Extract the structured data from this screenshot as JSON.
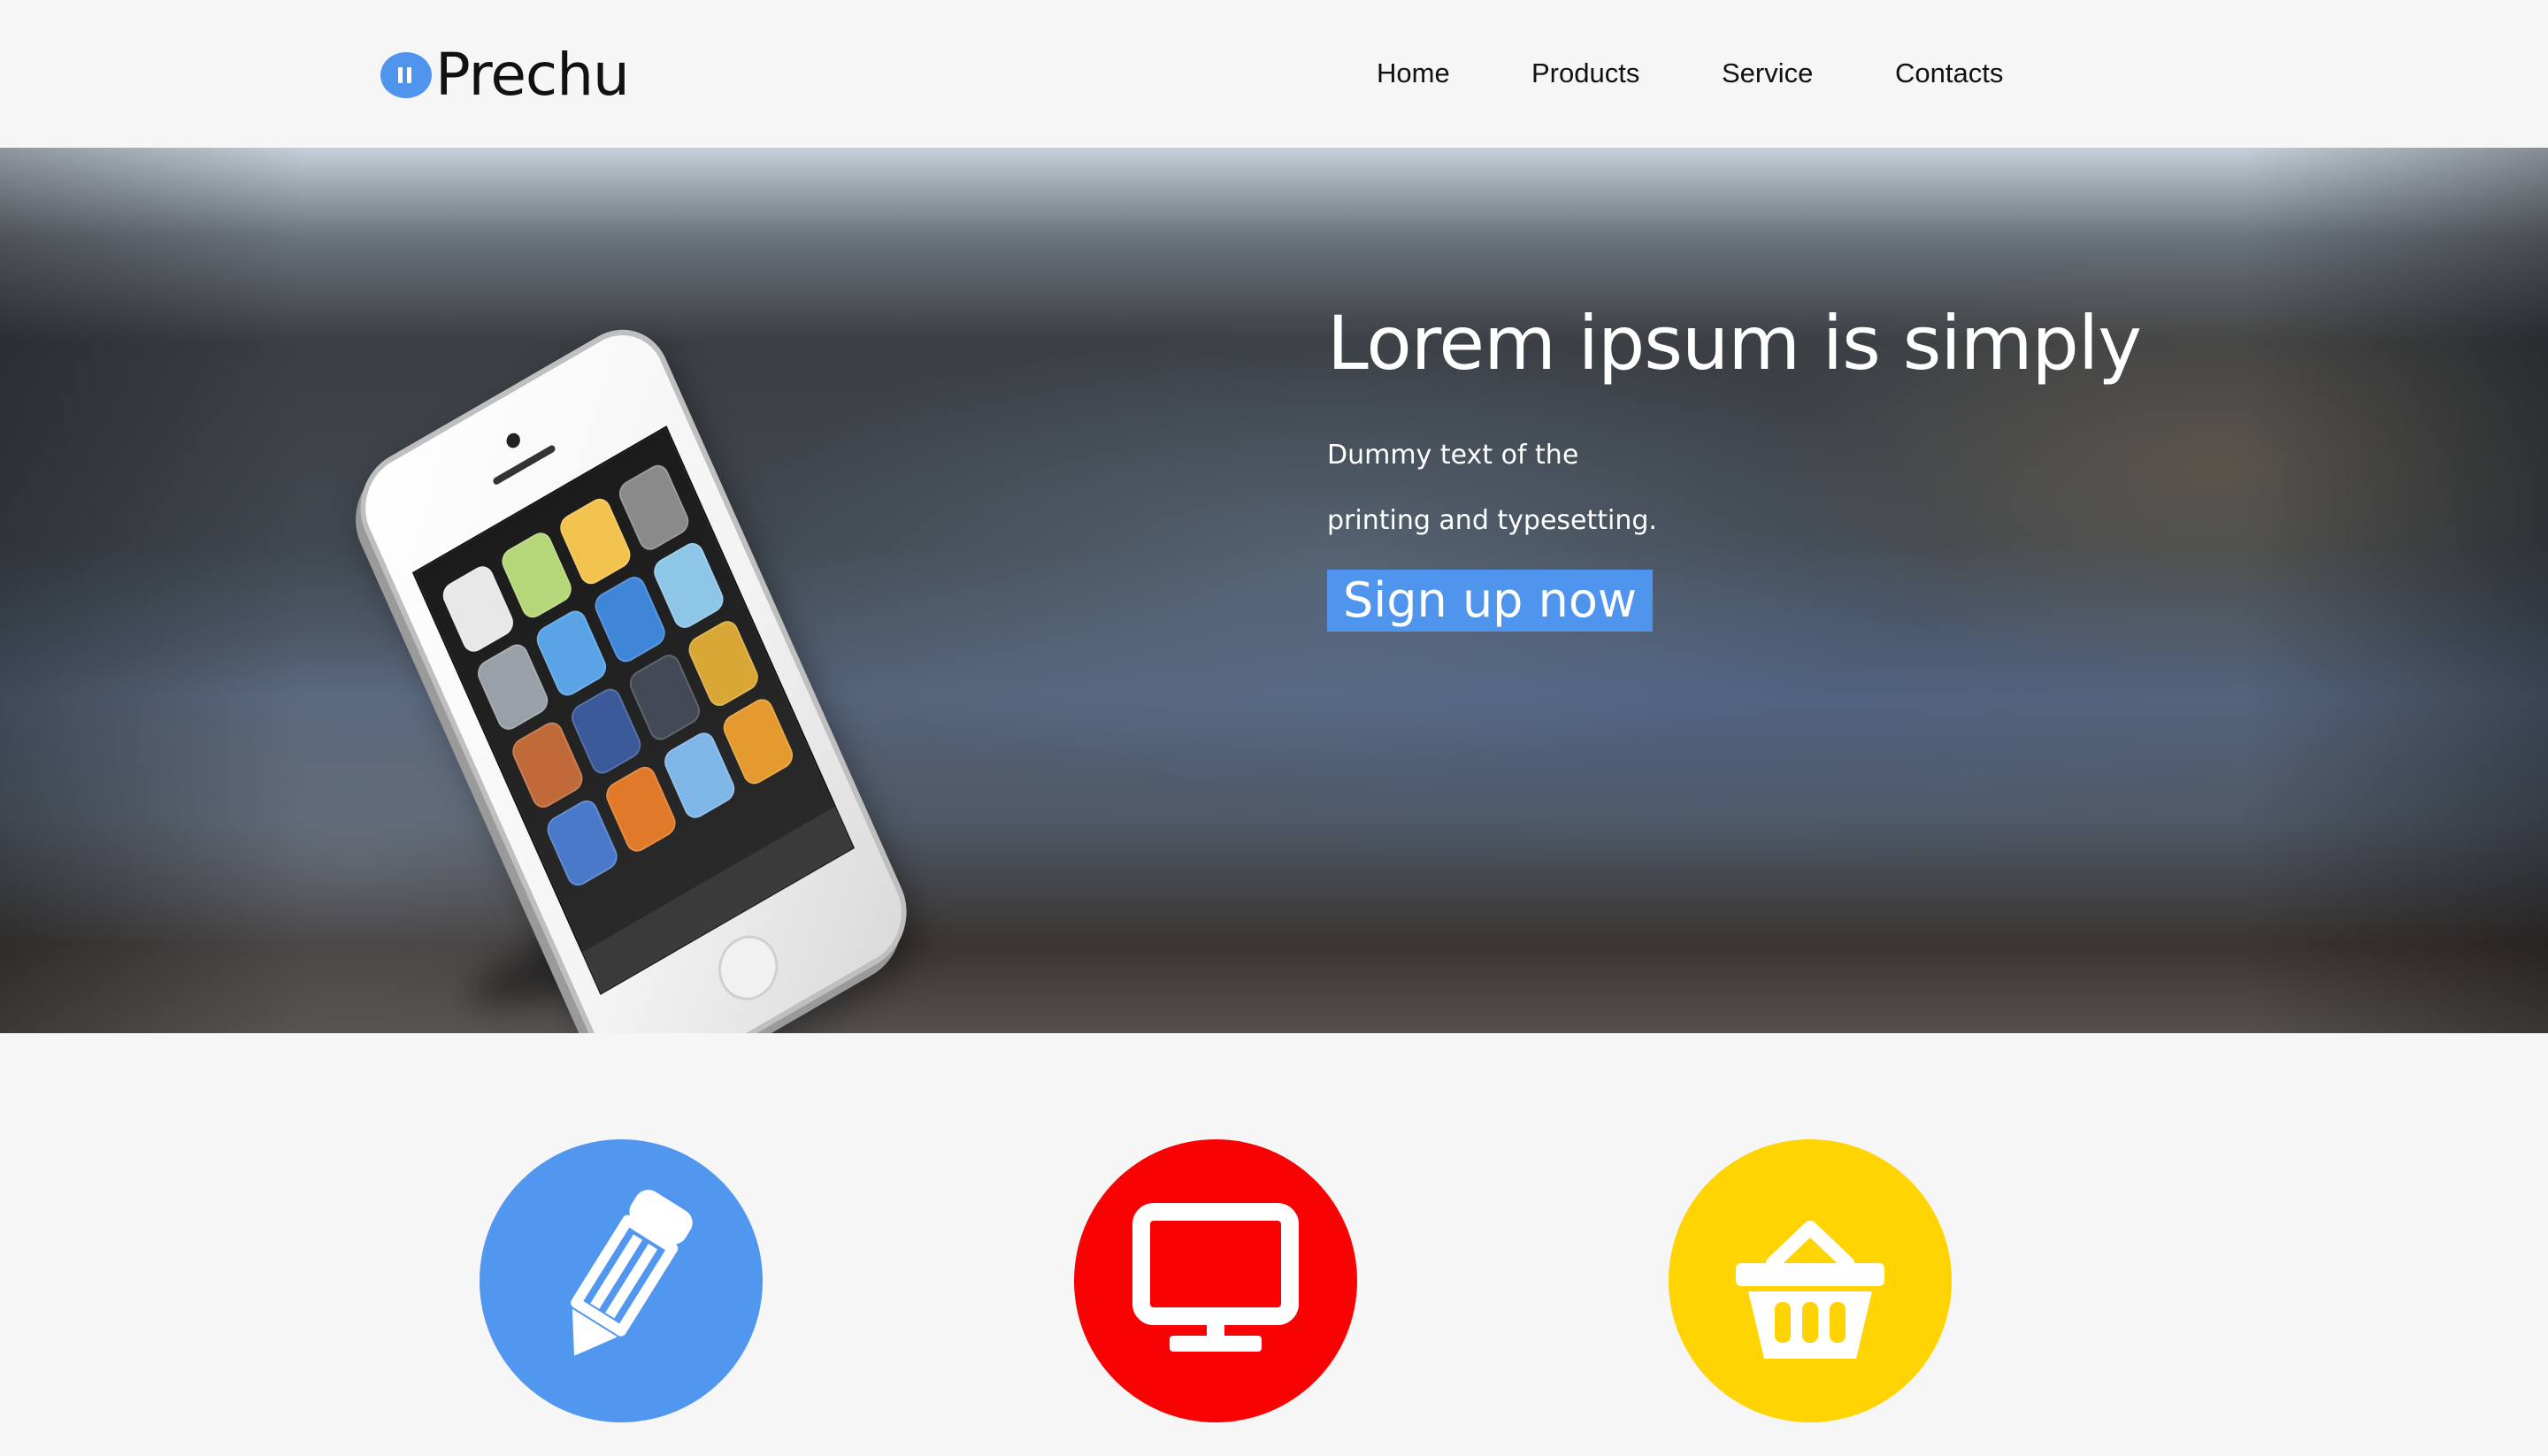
{
  "brand": {
    "name": "Prechu",
    "logo_icon": "pause-circle-icon",
    "accent_color": "#4f95ee"
  },
  "nav": {
    "items": [
      {
        "label": "Home"
      },
      {
        "label": "Products"
      },
      {
        "label": "Service"
      },
      {
        "label": "Contacts"
      }
    ]
  },
  "hero": {
    "title": "Lorem ipsum is simply",
    "subtitle_line1": "Dummy text of the",
    "subtitle_line2": "printing and typesetting.",
    "cta_label": "Sign up now",
    "image": "iphone-mockup"
  },
  "features": [
    {
      "icon": "pencil-icon",
      "color": "#5196ef"
    },
    {
      "icon": "monitor-icon",
      "color": "#f90203"
    },
    {
      "icon": "basket-icon",
      "color": "#ffd402"
    }
  ]
}
